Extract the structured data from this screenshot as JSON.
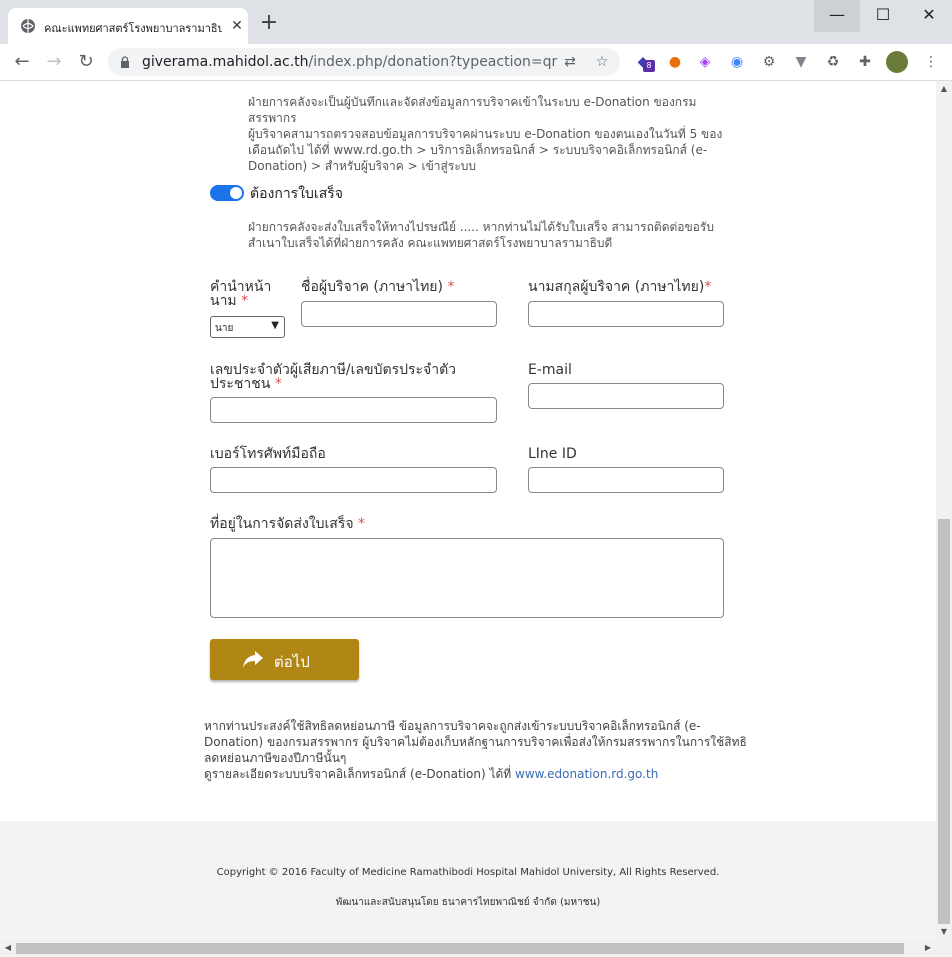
{
  "browser": {
    "tab_title": "คณะแพทยศาสตร์โรงพยาบาลรามาธิบดี มหาวิทยาลัยมหิดล",
    "url_host": "giverama.mahidol.ac.th",
    "url_path": "/index.php/donation?typeaction=qr",
    "extension_badge": "8",
    "new_tab": "+",
    "close_tab": "✕",
    "minimize": "—",
    "maximize": "☐",
    "close_window": "✕"
  },
  "notes": {
    "line1": "ฝ่ายการคลังจะเป็นผู้บันทึกและจัดส่งข้อมูลการบริจาคเข้าในระบบ e-Donation ของกรม",
    "line2": "สรรพากร",
    "line3": "ผู้บริจาคสามารถตรวจสอบข้อมูลการบริจาคผ่านระบบ e-Donation ของตนเองในวันที่ 5 ของ",
    "line4": "เดือนถัดไป ได้ที่ www.rd.go.th > บริการอิเล็กทรอนิกส์ > ระบบบริจาคอิเล็กทรอนิกส์ (e-",
    "line5": "Donation) > สำหรับผู้บริจาค > เข้าสู่ระบบ"
  },
  "receipt": {
    "toggle_label": "ต้องการใบเสร็จ",
    "toggle_on": true,
    "note1": "ฝ่ายการคลังจะส่งใบเสร็จให้ทางไปรษณีย์ ..... หากท่านไม่ได้รับใบเสร็จ สามารถติดต่อขอรับ",
    "note2": "สำเนาใบเสร็จได้ที่ฝ่ายการคลัง คณะแพทยศาสตร์โรงพยาบาลรามาธิบดี"
  },
  "form": {
    "prefix_label_1": "คำนำหน้า",
    "prefix_label_2": "นาม",
    "prefix_value": "นาย",
    "firstname_label": "ชื่อผู้บริจาค (ภาษาไทย)",
    "lastname_label": "นามสกุลผู้บริจาค (ภาษาไทย)",
    "taxid_label_1": "เลขประจำตัวผู้เสียภาษี/เลขบัตรประจำตัว",
    "taxid_label_2": "ประชาชน",
    "email_label": "E-mail",
    "phone_label": "เบอร์โทรศัพท์มือถือ",
    "line_label": "LIne ID",
    "address_label": "ที่อยู่ในการจัดส่งใบเสร็จ",
    "required_mark": "*",
    "next_button": "ต่อไป"
  },
  "info": {
    "line1": "หากท่านประสงค์ใช้สิทธิลดหย่อนภาษี ข้อมูลการบริจาคจะถูกส่งเข้าระบบบริจาคอิเล็กทรอนิกส์ (e-",
    "line2": "Donation) ของกรมสรรพากร ผู้บริจาคไม่ต้องเก็บหลักฐานการบริจาคเพื่อส่งให้กรมสรรพากรในการใช้สิทธิ",
    "line3": "ลดหย่อนภาษีของปีภาษีนั้นๆ",
    "line4": "ดูรายละเอียดระบบบริจาคอิเล็กทรอนิกส์ (e-Donation) ได้ที่",
    "link": "www.edonation.rd.go.th"
  },
  "footer": {
    "copyright": "Copyright © 2016 Faculty of Medicine Ramathibodi Hospital Mahidol University, All Rights Reserved.",
    "developer": "พัฒนาและสนับสนุนโดย ธนาคารไทยพาณิชย์ จำกัด (มหาชน)"
  },
  "colors": {
    "accent": "#1a73e8",
    "button": "#b08614",
    "required": "#d9534f",
    "link": "#3a6cb3"
  },
  "icons": [
    "globe-icon",
    "close-icon",
    "plus-icon",
    "back-icon",
    "forward-icon",
    "reload-icon",
    "lock-icon",
    "translate-icon",
    "star-icon",
    "extension-icons",
    "puzzle-icon",
    "avatar",
    "menu-icon",
    "share-arrow-icon"
  ]
}
